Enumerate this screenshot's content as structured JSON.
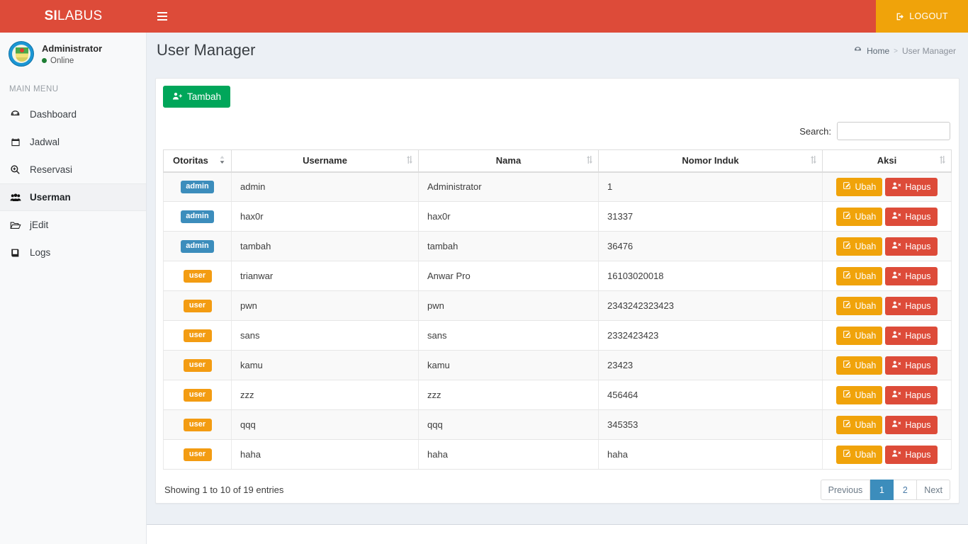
{
  "header": {
    "brand_bold": "SI",
    "brand_rest": "LABUS",
    "menu_toggle_label": "toggle-navigation",
    "logout_label": "LOGOUT"
  },
  "sidebar": {
    "profile": {
      "name": "Administrator",
      "status": "Online"
    },
    "section_title": "MAIN MENU",
    "items": [
      {
        "label": "Dashboard",
        "icon": "dashboard-icon",
        "active": false
      },
      {
        "label": "Jadwal",
        "icon": "calendar-icon",
        "active": false
      },
      {
        "label": "Reservasi",
        "icon": "search-plus-icon",
        "active": false
      },
      {
        "label": "Userman",
        "icon": "users-icon",
        "active": true
      },
      {
        "label": "jEdit",
        "icon": "folder-open-icon",
        "active": false
      },
      {
        "label": "Logs",
        "icon": "book-icon",
        "active": false
      }
    ]
  },
  "page": {
    "title": "User Manager",
    "breadcrumb": {
      "home": "Home",
      "separator": ">",
      "current": "User Manager"
    }
  },
  "toolbar": {
    "add_label": "Tambah"
  },
  "search": {
    "label": "Search:",
    "value": "",
    "placeholder": ""
  },
  "table": {
    "columns": [
      {
        "label": "Otoritas",
        "sorted": true
      },
      {
        "label": "Username",
        "sorted": false
      },
      {
        "label": "Nama",
        "sorted": false
      },
      {
        "label": "Nomor Induk",
        "sorted": false
      },
      {
        "label": "Aksi",
        "sorted": false
      }
    ],
    "action_labels": {
      "edit": "Ubah",
      "delete": "Hapus"
    },
    "rows": [
      {
        "otoritas": "admin",
        "username": "admin",
        "nama": "Administrator",
        "nomor_induk": "1"
      },
      {
        "otoritas": "admin",
        "username": "hax0r",
        "nama": "hax0r",
        "nomor_induk": "31337"
      },
      {
        "otoritas": "admin",
        "username": "tambah",
        "nama": "tambah",
        "nomor_induk": "36476"
      },
      {
        "otoritas": "user",
        "username": "trianwar",
        "nama": "Anwar Pro",
        "nomor_induk": "16103020018"
      },
      {
        "otoritas": "user",
        "username": "pwn",
        "nama": "pwn",
        "nomor_induk": "2343242323423"
      },
      {
        "otoritas": "user",
        "username": "sans",
        "nama": "sans",
        "nomor_induk": "2332423423"
      },
      {
        "otoritas": "user",
        "username": "kamu",
        "nama": "kamu",
        "nomor_induk": "23423"
      },
      {
        "otoritas": "user",
        "username": "zzz",
        "nama": "zzz",
        "nomor_induk": "456464"
      },
      {
        "otoritas": "user",
        "username": "qqq",
        "nama": "qqq",
        "nomor_induk": "345353"
      },
      {
        "otoritas": "user",
        "username": "haha",
        "nama": "haha",
        "nomor_induk": "haha"
      }
    ]
  },
  "footer": {
    "showing_info": "Showing 1 to 10 of 19 entries",
    "pagination": [
      {
        "label": "Previous",
        "active": false,
        "muted": true
      },
      {
        "label": "1",
        "active": true,
        "muted": false
      },
      {
        "label": "2",
        "active": false,
        "muted": false
      },
      {
        "label": "Next",
        "active": false,
        "muted": true
      }
    ]
  },
  "colors": {
    "header_red": "#dd4b39",
    "logout_orange": "#f0a30a",
    "add_green": "#00a65a",
    "badge_admin_blue": "#3c8dbc",
    "badge_user_orange": "#f39c12",
    "pagination_active": "#3c8dbc",
    "content_bg": "#ecf0f5"
  }
}
